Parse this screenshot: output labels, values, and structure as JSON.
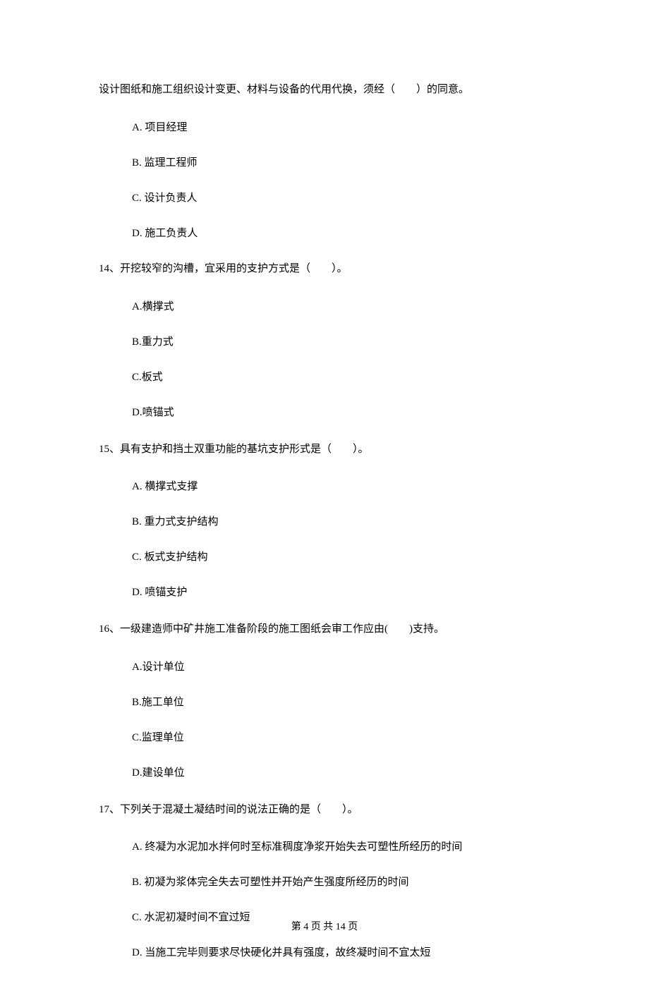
{
  "intro": "设计图纸和施工组织设计变更、材料与设备的代用代换，须经（　　）的同意。",
  "q13_options": {
    "a": "A.  项目经理",
    "b": "B.  监理工程师",
    "c": "C.  设计负责人",
    "d": "D.  施工负责人"
  },
  "q14_stem": "14、开挖较窄的沟槽，宜采用的支护方式是（　　）。",
  "q14_options": {
    "a": "A.横撑式",
    "b": "B.重力式",
    "c": "C.板式",
    "d": "D.喷锚式"
  },
  "q15_stem": "15、具有支护和挡土双重功能的基坑支护形式是（　　）。",
  "q15_options": {
    "a": "A.  横撑式支撑",
    "b": "B.  重力式支护结构",
    "c": "C.  板式支护结构",
    "d": "D.  喷锚支护"
  },
  "q16_stem": "16、一级建造师中矿井施工准备阶段的施工图纸会审工作应由(　　)支持。",
  "q16_options": {
    "a": "A.设计单位",
    "b": "B.施工单位",
    "c": "C.监理单位",
    "d": "D.建设单位"
  },
  "q17_stem": "17、下列关于混凝土凝结时间的说法正确的是（　　）。",
  "q17_options": {
    "a": "A.  终凝为水泥加水拌何时至标准稠度净浆开始失去可塑性所经历的时间",
    "b": "B.  初凝为浆体完全失去可塑性并开始产生强度所经历的时间",
    "c": "C.  水泥初凝时间不宜过短",
    "d": "D.  当施工完毕则要求尽快硬化并具有强度，故终凝时间不宜太短"
  },
  "footer": "第 4 页 共 14 页"
}
